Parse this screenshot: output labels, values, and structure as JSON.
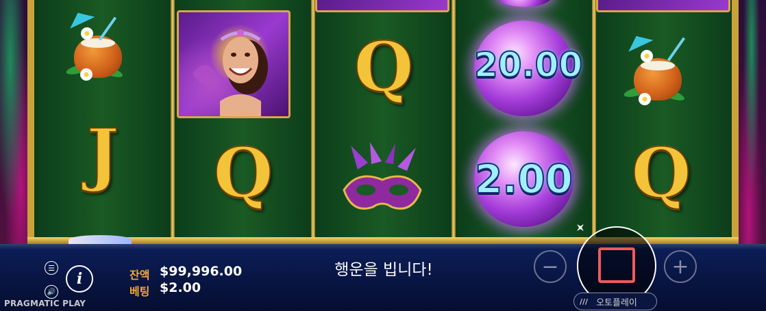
{
  "game": {
    "message": "행운을 빕니다!",
    "brand": "PRAGMATIC PLAY"
  },
  "reels": {
    "col1": [
      "coconut-cocktail",
      "J"
    ],
    "col2": [
      "carnival-dancer",
      "Q"
    ],
    "col3": [
      "Q",
      "carnival-mask"
    ],
    "col4": [
      "disco-ball-20",
      "disco-ball-2"
    ],
    "col5": [
      "coconut-cocktail",
      "Q"
    ],
    "letters": {
      "j": "J",
      "q": "Q"
    },
    "disco_values": {
      "top": "20.00",
      "bottom": "2.00"
    }
  },
  "stats": {
    "balance_label": "잔액",
    "balance_value": "$99,996.00",
    "bet_label": "베팅",
    "bet_value": "$2.00"
  },
  "controls": {
    "minus": "−",
    "plus": "+",
    "info": "i",
    "menu_icon": "☰",
    "sound_icon": "🔊",
    "autoplay_icon": "///",
    "autoplay_label": "오토플레이"
  },
  "colors": {
    "reel_bg": "#1a5a24",
    "gold": "#f3c33a",
    "bar_bg": "#081440",
    "stop_red": "#f05a5a",
    "label_orange": "#f4a638"
  }
}
